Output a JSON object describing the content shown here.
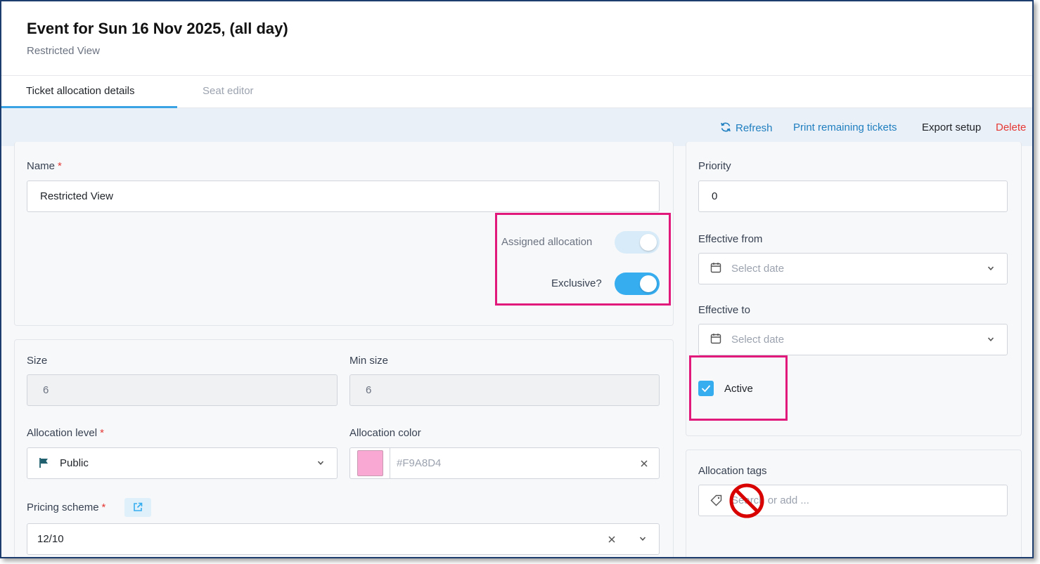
{
  "header": {
    "title": "Event for Sun 16 Nov 2025, (all day)",
    "subtitle": "Restricted View"
  },
  "tabs": [
    {
      "label": "Ticket allocation details",
      "active": true
    },
    {
      "label": "Seat editor",
      "active": false
    }
  ],
  "toolbar": {
    "refresh": "Refresh",
    "print": "Print remaining tickets",
    "export": "Export setup",
    "delete": "Delete"
  },
  "form": {
    "name_label": "Name",
    "name_value": "Restricted View",
    "required_mark": "*",
    "assigned_label": "Assigned allocation",
    "exclusive_label": "Exclusive?",
    "size_label": "Size",
    "size_value": "6",
    "min_size_label": "Min size",
    "min_size_value": "6",
    "allocation_level_label": "Allocation level",
    "allocation_level_value": "Public",
    "allocation_color_label": "Allocation color",
    "allocation_color_value": "#F9A8D4",
    "pricing_scheme_label": "Pricing scheme",
    "pricing_scheme_value": "12/10"
  },
  "side": {
    "priority_label": "Priority",
    "priority_value": "0",
    "effective_from_label": "Effective from",
    "effective_to_label": "Effective to",
    "date_placeholder": "Select date",
    "active_label": "Active",
    "tags_label": "Allocation tags",
    "tags_placeholder": "Search or add ..."
  },
  "colors": {
    "accent": "#36adef",
    "highlight": "#e0197b",
    "danger": "#e53935",
    "swatch": "#F9A8D4"
  }
}
